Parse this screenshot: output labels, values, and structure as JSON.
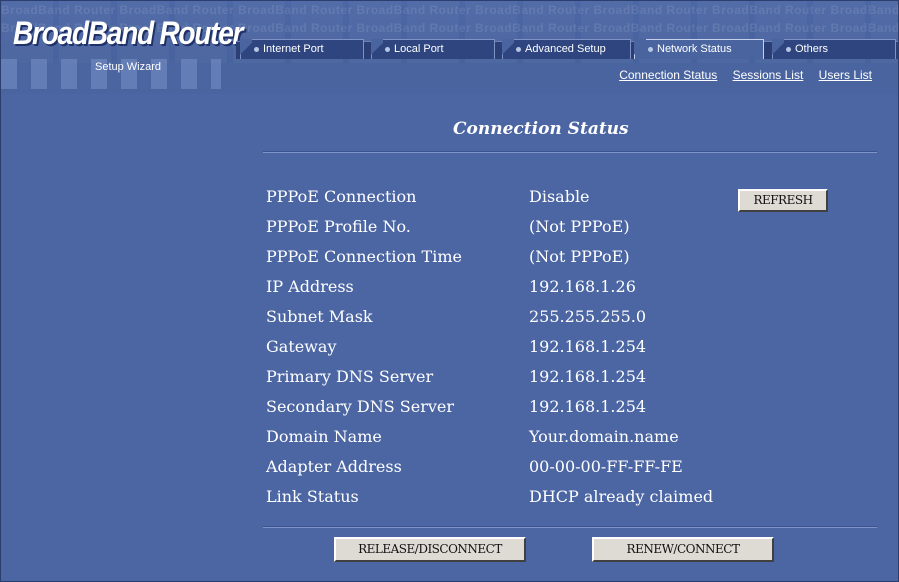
{
  "header": {
    "logo_text": "BroadBand Router",
    "wizard_label": "Setup Wizard",
    "watermark": "BroadBand Router  BroadBand Router  BroadBand Router  BroadBand Router  BroadBand Router  BroadBand Router  BroadBand Router  BroadBand Router  BroadBand Router"
  },
  "tabs": [
    {
      "label": "Internet Port",
      "active": false
    },
    {
      "label": "Local Port",
      "active": false
    },
    {
      "label": "Advanced Setup",
      "active": false
    },
    {
      "label": "Network Status",
      "active": true
    },
    {
      "label": "Others",
      "active": false
    }
  ],
  "sublinks": [
    {
      "label": "Connection Status"
    },
    {
      "label": "Sessions List"
    },
    {
      "label": "Users List"
    }
  ],
  "page": {
    "title": "Connection Status"
  },
  "status": [
    {
      "label": "PPPoE Connection",
      "value": "Disable"
    },
    {
      "label": "PPPoE Profile No.",
      "value": "(Not PPPoE)"
    },
    {
      "label": "PPPoE Connection Time",
      "value": "(Not PPPoE)"
    },
    {
      "label": "IP Address",
      "value": "192.168.1.26"
    },
    {
      "label": "Subnet Mask",
      "value": "255.255.255.0"
    },
    {
      "label": "Gateway",
      "value": "192.168.1.254"
    },
    {
      "label": "Primary DNS Server",
      "value": "192.168.1.254"
    },
    {
      "label": "Secondary DNS Server",
      "value": "192.168.1.254"
    },
    {
      "label": "Domain Name",
      "value": "Your.domain.name"
    },
    {
      "label": "Adapter Address",
      "value": "00-00-00-FF-FF-FE"
    },
    {
      "label": "Link Status",
      "value": "DHCP already claimed"
    }
  ],
  "buttons": {
    "refresh": "REFRESH",
    "release": "RELEASE/DISCONNECT",
    "renew": "RENEW/CONNECT"
  },
  "colors": {
    "background": "#4b66a3",
    "tab_bar": "#2b3f75",
    "button_face": "#dedbd5",
    "text": "#ffffff"
  }
}
